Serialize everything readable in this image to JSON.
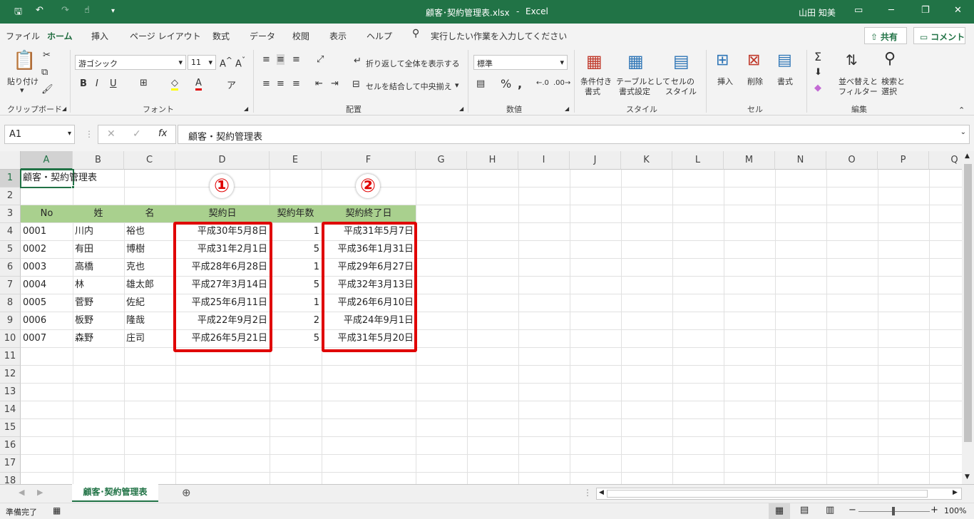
{
  "titlebar": {
    "filename": "顧客･契約管理表.xlsx",
    "sep": "-",
    "app": "Excel",
    "user": "山田 知美"
  },
  "menu": {
    "tabs": [
      "ファイル",
      "ホーム",
      "挿入",
      "ページ レイアウト",
      "数式",
      "データ",
      "校閲",
      "表示",
      "ヘルプ"
    ],
    "tellme": "実行したい作業を入力してください",
    "share": "共有",
    "comment": "コメント"
  },
  "ribbon": {
    "paste": "貼り付け",
    "font_name": "游ゴシック",
    "font_size": "11",
    "wrap_text": "折り返して全体を表示する",
    "merge_center": "セルを結合して中央揃え",
    "number_format": "標準",
    "cond_format": [
      "条件付き",
      "書式"
    ],
    "table_format": [
      "テーブルとして",
      "書式設定"
    ],
    "cell_style": [
      "セルの",
      "スタイル"
    ],
    "insert": "挿入",
    "delete": "削除",
    "format": "書式",
    "sort_filter": [
      "並べ替えと",
      "フィルター"
    ],
    "find_select": [
      "検索と",
      "選択"
    ],
    "groups": [
      "クリップボード",
      "フォント",
      "配置",
      "数値",
      "スタイル",
      "セル",
      "編集"
    ]
  },
  "formula": {
    "namebox": "A1",
    "content": "顧客・契約管理表"
  },
  "columns": [
    "A",
    "B",
    "C",
    "D",
    "E",
    "F",
    "G",
    "H",
    "I",
    "J",
    "K",
    "L",
    "M",
    "N",
    "O",
    "P",
    "Q"
  ],
  "rows": [
    "1",
    "2",
    "3",
    "4",
    "5",
    "6",
    "7",
    "8",
    "9",
    "10",
    "11",
    "12",
    "13",
    "14",
    "15",
    "16",
    "17",
    "18"
  ],
  "sheet": {
    "title": "顧客・契約管理表",
    "headers": [
      "No",
      "姓",
      "名",
      "契約日",
      "契約年数",
      "契約終了日"
    ],
    "records": [
      [
        "0001",
        "川内",
        "裕也",
        "平成30年5月8日",
        "1",
        "平成31年5月7日"
      ],
      [
        "0002",
        "有田",
        "博樹",
        "平成31年2月1日",
        "5",
        "平成36年1月31日"
      ],
      [
        "0003",
        "高橋",
        "克也",
        "平成28年6月28日",
        "1",
        "平成29年6月27日"
      ],
      [
        "0004",
        "林",
        "雄太郎",
        "平成27年3月14日",
        "5",
        "平成32年3月13日"
      ],
      [
        "0005",
        "菅野",
        "佐紀",
        "平成25年6月11日",
        "1",
        "平成26年6月10日"
      ],
      [
        "0006",
        "板野",
        "隆哉",
        "平成22年9月2日",
        "2",
        "平成24年9月1日"
      ],
      [
        "0007",
        "森野",
        "庄司",
        "平成26年5月21日",
        "5",
        "平成31年5月20日"
      ]
    ]
  },
  "annotations": {
    "marker1": "①",
    "marker2": "②",
    "color": "#e00000"
  },
  "sheettab": "顧客･契約管理表",
  "status": {
    "ready": "準備完了",
    "zoom": "100%"
  },
  "colors": {
    "accent": "#217346",
    "header_fill": "#a9d08e"
  }
}
